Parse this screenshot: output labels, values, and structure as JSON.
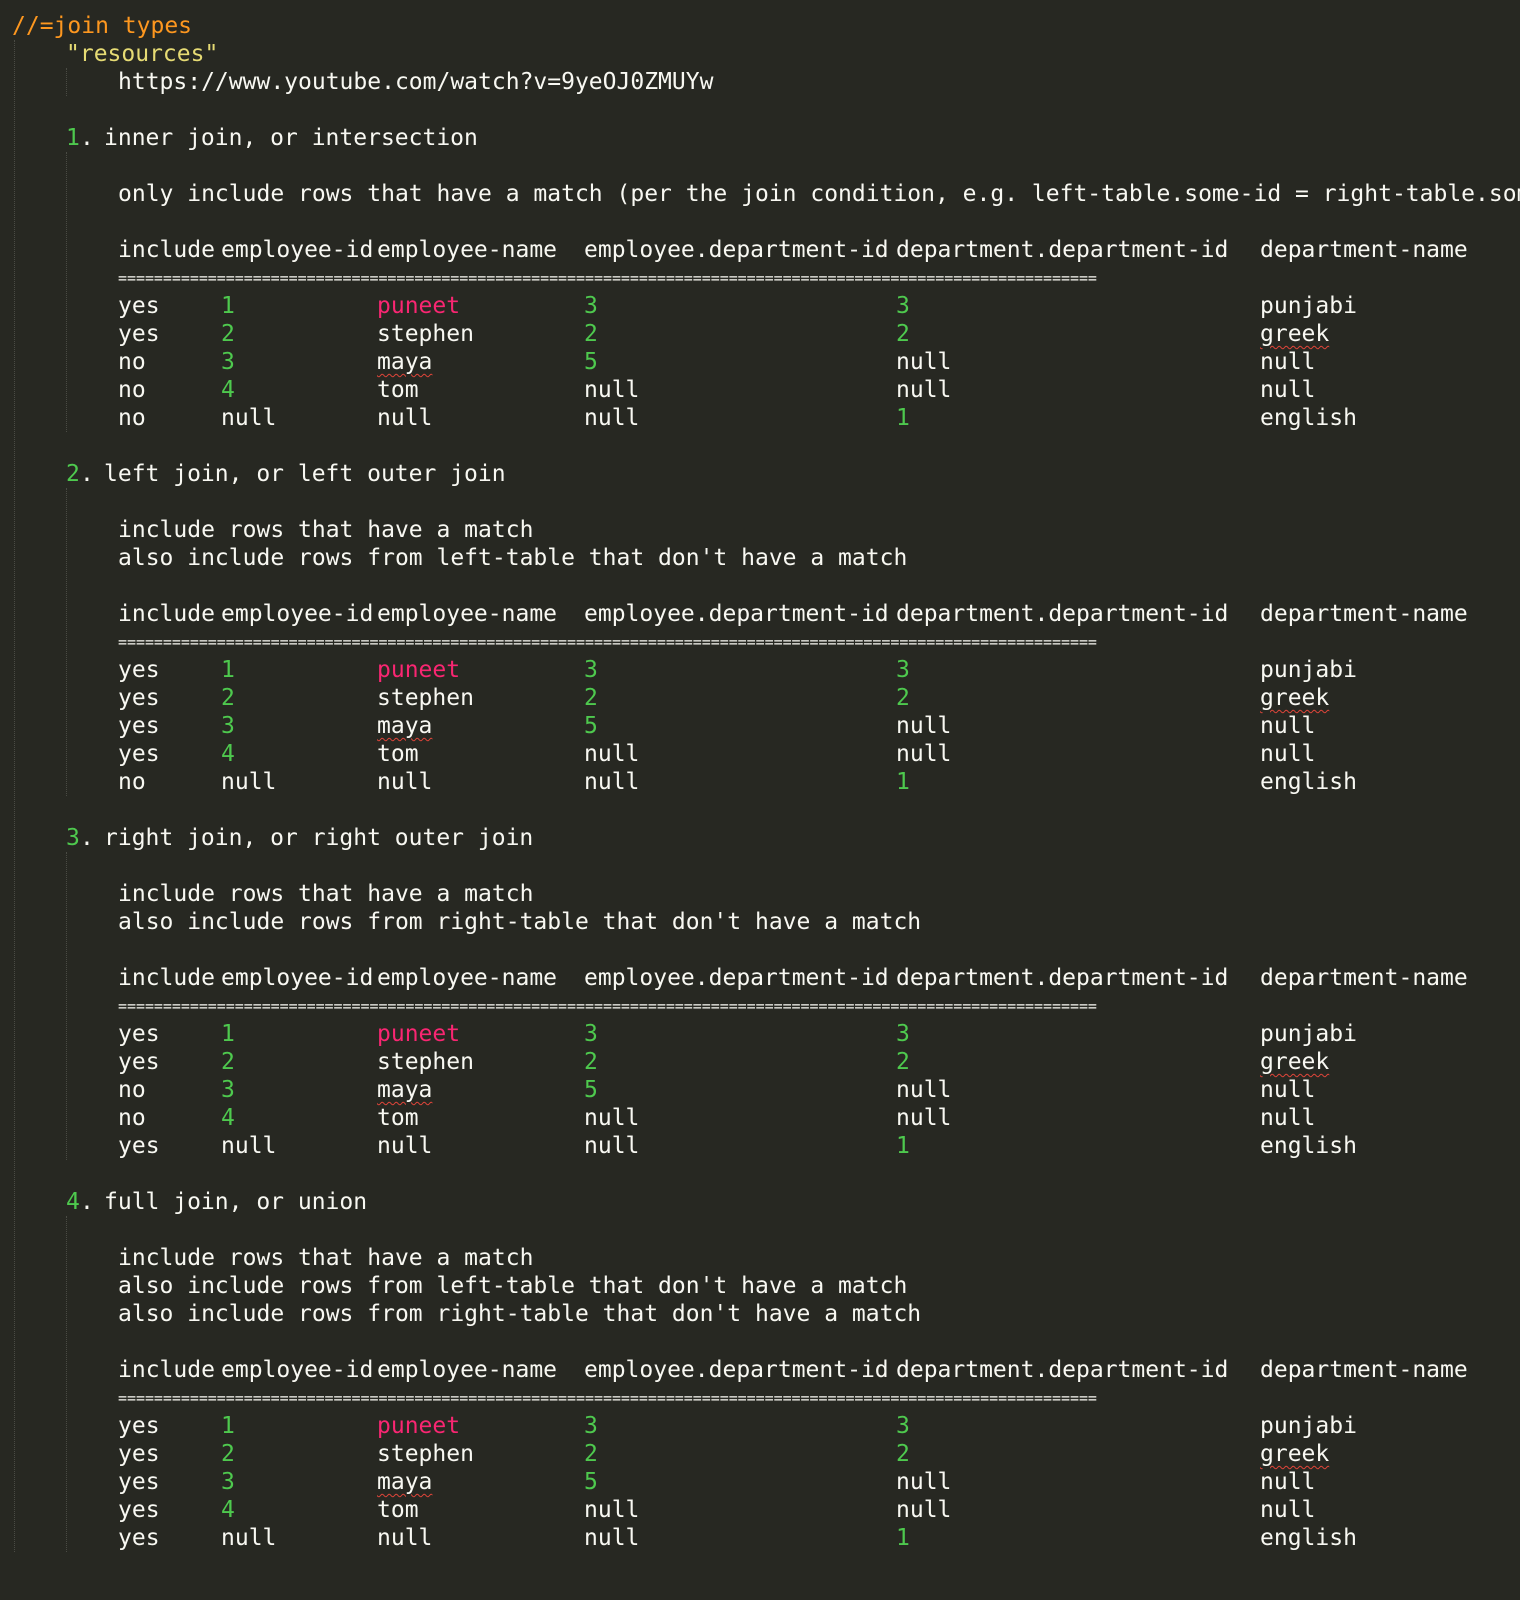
{
  "editor": {
    "comment": "//=join types",
    "resources_key": "\"resources\"",
    "resource_url": "https://www.youtube.com/watch?v=9yeOJ0ZMUYw",
    "separator": "============================================================================================================="
  },
  "columns": {
    "include": "include",
    "employee_id": "employee-id",
    "employee_name": "employee-name",
    "employee_department_id": "employee.department-id",
    "department_department_id": "department.department-id",
    "department_name": "department-name"
  },
  "sections": [
    {
      "number": "1",
      "dot": ".",
      "heading": "inner join, or intersection",
      "notes": [
        "only include rows that have a match (per the join condition, e.g. left-table.some-id = right-table.some-id"
      ],
      "rows": [
        [
          "yes",
          "1",
          "puneet",
          "3",
          "3",
          "punjabi"
        ],
        [
          "yes",
          "2",
          "stephen",
          "2",
          "2",
          "greek"
        ],
        [
          "no",
          "3",
          "maya",
          "5",
          "null",
          "null"
        ],
        [
          "no",
          "4",
          "tom",
          "null",
          "null",
          "null"
        ],
        [
          "no",
          "null",
          "null",
          "null",
          "1",
          "english"
        ]
      ]
    },
    {
      "number": "2",
      "dot": ".",
      "heading": "left join, or left outer join",
      "notes": [
        "include rows that have a match",
        "also include rows from left-table that don't have a match"
      ],
      "rows": [
        [
          "yes",
          "1",
          "puneet",
          "3",
          "3",
          "punjabi"
        ],
        [
          "yes",
          "2",
          "stephen",
          "2",
          "2",
          "greek"
        ],
        [
          "yes",
          "3",
          "maya",
          "5",
          "null",
          "null"
        ],
        [
          "yes",
          "4",
          "tom",
          "null",
          "null",
          "null"
        ],
        [
          "no",
          "null",
          "null",
          "null",
          "1",
          "english"
        ]
      ]
    },
    {
      "number": "3",
      "dot": ".",
      "heading": "right join, or right outer join",
      "notes": [
        "include rows that have a match",
        "also include rows from right-table that don't have a match"
      ],
      "rows": [
        [
          "yes",
          "1",
          "puneet",
          "3",
          "3",
          "punjabi"
        ],
        [
          "yes",
          "2",
          "stephen",
          "2",
          "2",
          "greek"
        ],
        [
          "no",
          "3",
          "maya",
          "5",
          "null",
          "null"
        ],
        [
          "no",
          "4",
          "tom",
          "null",
          "null",
          "null"
        ],
        [
          "yes",
          "null",
          "null",
          "null",
          "1",
          "english"
        ]
      ]
    },
    {
      "number": "4",
      "dot": ".",
      "heading": "full join, or union",
      "notes": [
        "include rows that have a match",
        "also include rows from left-table that don't have a match",
        "also include rows from right-table that don't have a match"
      ],
      "rows": [
        [
          "yes",
          "1",
          "puneet",
          "3",
          "3",
          "punjabi"
        ],
        [
          "yes",
          "2",
          "stephen",
          "2",
          "2",
          "greek"
        ],
        [
          "yes",
          "3",
          "maya",
          "5",
          "null",
          "null"
        ],
        [
          "yes",
          "4",
          "tom",
          "null",
          "null",
          "null"
        ],
        [
          "yes",
          "null",
          "null",
          "null",
          "1",
          "english"
        ]
      ]
    }
  ],
  "colors": {
    "background": "#272822",
    "text": "#f8f8f2",
    "comment": "#fd971f",
    "string": "#e6db74",
    "number": "#4ec94e",
    "highlight_name": "#f92672",
    "spell_error": "#e0453a"
  }
}
